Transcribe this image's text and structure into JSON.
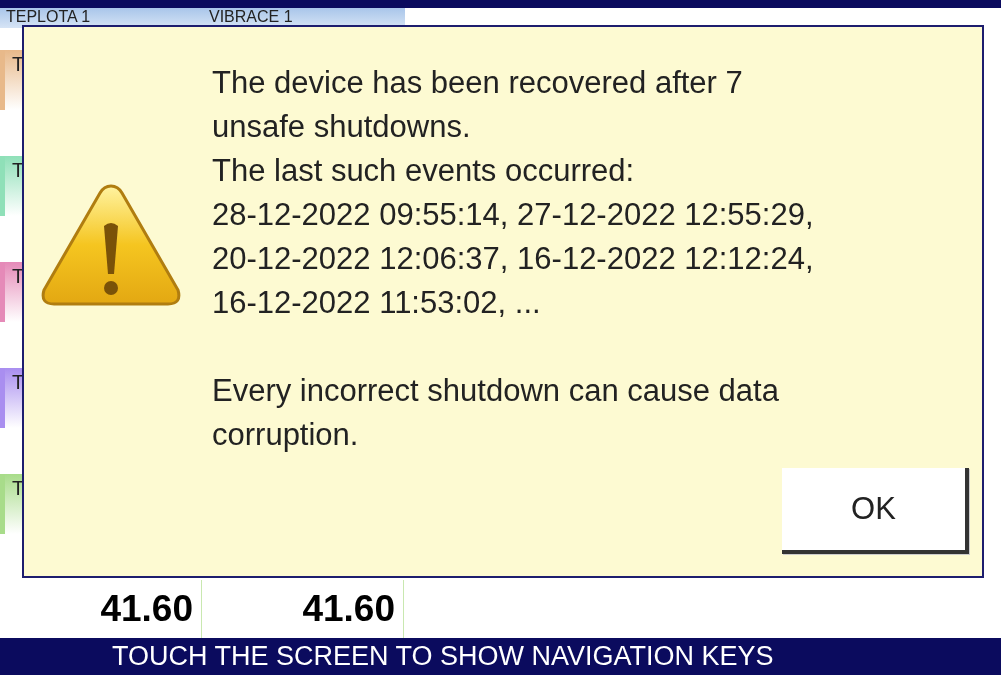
{
  "header": {
    "columns": [
      "TEPLOTA 1",
      "VIBRACE 1"
    ]
  },
  "channels": [
    {
      "label": "T",
      "color": "#e8b98a"
    },
    {
      "label": "T",
      "color": "#8fe0b8"
    },
    {
      "label": "T",
      "color": "#e58ab8"
    },
    {
      "label": "T",
      "color": "#a98ef0"
    },
    {
      "label": "T",
      "color": "#a8dc8a"
    }
  ],
  "readings": [
    "41.60",
    "41.60"
  ],
  "dialog": {
    "message_blocks": [
      [
        {
          "lines": [
            "The device has been recovered after 7",
            "unsafe shutdowns."
          ]
        },
        {
          "lines": [
            "The last such events occurred:",
            "28-12-2022 09:55:14, 27-12-2022 12:55:29,",
            "20-12-2022 12:06:37, 16-12-2022 12:12:24,",
            "16-12-2022 11:53:02, ..."
          ]
        }
      ],
      [
        {
          "lines": [
            "Every incorrect shutdown can cause data",
            "corruption."
          ]
        }
      ]
    ],
    "buttons": [
      "OK"
    ]
  },
  "status_bar": "TOUCH THE SCREEN TO SHOW NAVIGATION KEYS"
}
